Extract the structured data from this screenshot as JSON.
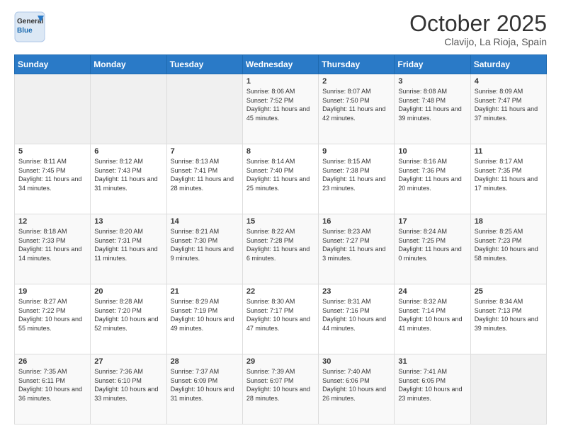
{
  "header": {
    "logo_line1": "General",
    "logo_line2": "Blue",
    "month": "October 2025",
    "location": "Clavijo, La Rioja, Spain"
  },
  "weekdays": [
    "Sunday",
    "Monday",
    "Tuesday",
    "Wednesday",
    "Thursday",
    "Friday",
    "Saturday"
  ],
  "weeks": [
    [
      {
        "day": "",
        "info": ""
      },
      {
        "day": "",
        "info": ""
      },
      {
        "day": "",
        "info": ""
      },
      {
        "day": "1",
        "info": "Sunrise: 8:06 AM\nSunset: 7:52 PM\nDaylight: 11 hours and 45 minutes."
      },
      {
        "day": "2",
        "info": "Sunrise: 8:07 AM\nSunset: 7:50 PM\nDaylight: 11 hours and 42 minutes."
      },
      {
        "day": "3",
        "info": "Sunrise: 8:08 AM\nSunset: 7:48 PM\nDaylight: 11 hours and 39 minutes."
      },
      {
        "day": "4",
        "info": "Sunrise: 8:09 AM\nSunset: 7:47 PM\nDaylight: 11 hours and 37 minutes."
      }
    ],
    [
      {
        "day": "5",
        "info": "Sunrise: 8:11 AM\nSunset: 7:45 PM\nDaylight: 11 hours and 34 minutes."
      },
      {
        "day": "6",
        "info": "Sunrise: 8:12 AM\nSunset: 7:43 PM\nDaylight: 11 hours and 31 minutes."
      },
      {
        "day": "7",
        "info": "Sunrise: 8:13 AM\nSunset: 7:41 PM\nDaylight: 11 hours and 28 minutes."
      },
      {
        "day": "8",
        "info": "Sunrise: 8:14 AM\nSunset: 7:40 PM\nDaylight: 11 hours and 25 minutes."
      },
      {
        "day": "9",
        "info": "Sunrise: 8:15 AM\nSunset: 7:38 PM\nDaylight: 11 hours and 23 minutes."
      },
      {
        "day": "10",
        "info": "Sunrise: 8:16 AM\nSunset: 7:36 PM\nDaylight: 11 hours and 20 minutes."
      },
      {
        "day": "11",
        "info": "Sunrise: 8:17 AM\nSunset: 7:35 PM\nDaylight: 11 hours and 17 minutes."
      }
    ],
    [
      {
        "day": "12",
        "info": "Sunrise: 8:18 AM\nSunset: 7:33 PM\nDaylight: 11 hours and 14 minutes."
      },
      {
        "day": "13",
        "info": "Sunrise: 8:20 AM\nSunset: 7:31 PM\nDaylight: 11 hours and 11 minutes."
      },
      {
        "day": "14",
        "info": "Sunrise: 8:21 AM\nSunset: 7:30 PM\nDaylight: 11 hours and 9 minutes."
      },
      {
        "day": "15",
        "info": "Sunrise: 8:22 AM\nSunset: 7:28 PM\nDaylight: 11 hours and 6 minutes."
      },
      {
        "day": "16",
        "info": "Sunrise: 8:23 AM\nSunset: 7:27 PM\nDaylight: 11 hours and 3 minutes."
      },
      {
        "day": "17",
        "info": "Sunrise: 8:24 AM\nSunset: 7:25 PM\nDaylight: 11 hours and 0 minutes."
      },
      {
        "day": "18",
        "info": "Sunrise: 8:25 AM\nSunset: 7:23 PM\nDaylight: 10 hours and 58 minutes."
      }
    ],
    [
      {
        "day": "19",
        "info": "Sunrise: 8:27 AM\nSunset: 7:22 PM\nDaylight: 10 hours and 55 minutes."
      },
      {
        "day": "20",
        "info": "Sunrise: 8:28 AM\nSunset: 7:20 PM\nDaylight: 10 hours and 52 minutes."
      },
      {
        "day": "21",
        "info": "Sunrise: 8:29 AM\nSunset: 7:19 PM\nDaylight: 10 hours and 49 minutes."
      },
      {
        "day": "22",
        "info": "Sunrise: 8:30 AM\nSunset: 7:17 PM\nDaylight: 10 hours and 47 minutes."
      },
      {
        "day": "23",
        "info": "Sunrise: 8:31 AM\nSunset: 7:16 PM\nDaylight: 10 hours and 44 minutes."
      },
      {
        "day": "24",
        "info": "Sunrise: 8:32 AM\nSunset: 7:14 PM\nDaylight: 10 hours and 41 minutes."
      },
      {
        "day": "25",
        "info": "Sunrise: 8:34 AM\nSunset: 7:13 PM\nDaylight: 10 hours and 39 minutes."
      }
    ],
    [
      {
        "day": "26",
        "info": "Sunrise: 7:35 AM\nSunset: 6:11 PM\nDaylight: 10 hours and 36 minutes."
      },
      {
        "day": "27",
        "info": "Sunrise: 7:36 AM\nSunset: 6:10 PM\nDaylight: 10 hours and 33 minutes."
      },
      {
        "day": "28",
        "info": "Sunrise: 7:37 AM\nSunset: 6:09 PM\nDaylight: 10 hours and 31 minutes."
      },
      {
        "day": "29",
        "info": "Sunrise: 7:39 AM\nSunset: 6:07 PM\nDaylight: 10 hours and 28 minutes."
      },
      {
        "day": "30",
        "info": "Sunrise: 7:40 AM\nSunset: 6:06 PM\nDaylight: 10 hours and 26 minutes."
      },
      {
        "day": "31",
        "info": "Sunrise: 7:41 AM\nSunset: 6:05 PM\nDaylight: 10 hours and 23 minutes."
      },
      {
        "day": "",
        "info": ""
      }
    ]
  ]
}
